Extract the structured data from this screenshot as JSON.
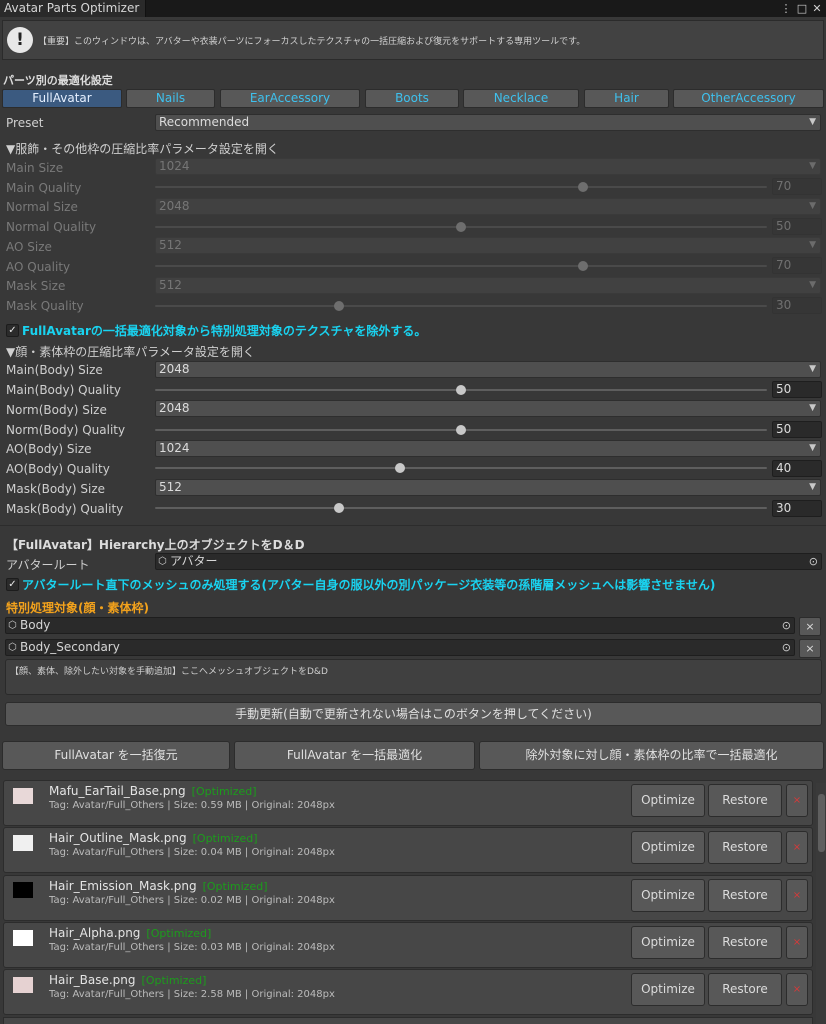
{
  "window": {
    "title": "Avatar Parts Optimizer",
    "menu_icon": "⋮",
    "maximize_icon": "□",
    "close_icon": "✕"
  },
  "notice": {
    "icon": "!",
    "text": "【重要】このウィンドウは、アバターや衣装パーツにフォーカスしたテクスチャの一括圧縮および復元をサポートする専用ツールです。"
  },
  "section_title": "パーツ別の最適化設定",
  "tabs": [
    "FullAvatar",
    "Nails",
    "EarAccessory",
    "Boots",
    "Necklace",
    "Hair",
    "OtherAccessory"
  ],
  "active_tab": "FullAvatar",
  "preset": {
    "label": "Preset",
    "value": "Recommended"
  },
  "arrow_glyph": "▼",
  "others_foldout": "▼服飾・その他枠の圧縮比率パラメータ設定を開く",
  "others_params": [
    {
      "label": "Main Size",
      "value": "1024"
    },
    {
      "label": "Main Quality",
      "value": 70
    },
    {
      "label": "Normal Size",
      "value": "2048"
    },
    {
      "label": "Normal Quality",
      "value": 50
    },
    {
      "label": "AO Size",
      "value": "512"
    },
    {
      "label": "AO Quality",
      "value": 70
    },
    {
      "label": "Mask Size",
      "value": "512"
    },
    {
      "label": "Mask Quality",
      "value": 30
    }
  ],
  "exclude_check": {
    "checked": true,
    "mark": "✓",
    "text": "FullAvatarの一括最適化対象から特別処理対象のテクスチャを除外する。"
  },
  "body_foldout": "▼顔・素体枠の圧縮比率パラメータ設定を開く",
  "body_params": [
    {
      "label": "Main(Body) Size",
      "value": "2048"
    },
    {
      "label": "Main(Body) Quality",
      "value": 50
    },
    {
      "label": "Norm(Body) Size",
      "value": "2048"
    },
    {
      "label": "Norm(Body) Quality",
      "value": 50
    },
    {
      "label": "AO(Body) Size",
      "value": "1024"
    },
    {
      "label": "AO(Body) Quality",
      "value": 40
    },
    {
      "label": "Mask(Body) Size",
      "value": "512"
    },
    {
      "label": "Mask(Body) Quality",
      "value": 30
    }
  ],
  "hierarchy_title": "【FullAvatar】Hierarchy上のオブジェクトをD＆D",
  "avatar_root": {
    "label": "アバタールート",
    "value": "アバター"
  },
  "mesh_check": {
    "checked": true,
    "mark": "✓",
    "text": "アバタールート直下のメッシュのみ処理する(アバター自身の服以外の別パッケージ衣装等の孫階層メッシュへは影響させません)"
  },
  "special_title": "特別処理対象(顔・素体枠)",
  "special_objects": [
    "Body",
    "Body_Secondary"
  ],
  "object_icons": {
    "cube": "⬡",
    "target": "⊙",
    "remove": "×"
  },
  "dropzone_text": "【顔、素体、除外したい対象を手動追加】ここへメッシュオブジェクトをD&D",
  "manual_update_button": "手動更新(自動で更新されない場合はこのボタンを押してください)",
  "bulk_buttons": [
    "FullAvatar を一括復元",
    "FullAvatar を一括最適化",
    "除外対象に対し顔・素体枠の比率で一括最適化"
  ],
  "textures": [
    {
      "name": "Mafu_EarTail_Base.png",
      "status": "[Optimized]",
      "meta": "Tag: Avatar/Full_Others | Size: 0.59 MB | Original: 2048px",
      "thumb_color": "#e8d8d8"
    },
    {
      "name": "Hair_Outline_Mask.png",
      "status": "[Optimized]",
      "meta": "Tag: Avatar/Full_Others | Size: 0.04 MB | Original: 2048px",
      "thumb_color": "#f0f0f0"
    },
    {
      "name": "Hair_Emission_Mask.png",
      "status": "[Optimized]",
      "meta": "Tag: Avatar/Full_Others | Size: 0.02 MB | Original: 2048px",
      "thumb_color": "#000000"
    },
    {
      "name": "Hair_Alpha.png",
      "status": "[Optimized]",
      "meta": "Tag: Avatar/Full_Others | Size: 0.03 MB | Original: 2048px",
      "thumb_color": "#ffffff"
    },
    {
      "name": "Hair_Base.png",
      "status": "[Optimized]",
      "meta": "Tag: Avatar/Full_Others | Size: 2.58 MB | Original: 2048px",
      "thumb_color": "#e6d2d2"
    }
  ],
  "row_buttons": {
    "optimize": "Optimize",
    "restore": "Restore",
    "delete": "×"
  },
  "colors": {
    "accent_cyan": "#19d3f0",
    "accent_orange": "#f3a21c",
    "optimized_green": "#1c9c1c",
    "tab_text": "#3ec1ee"
  }
}
